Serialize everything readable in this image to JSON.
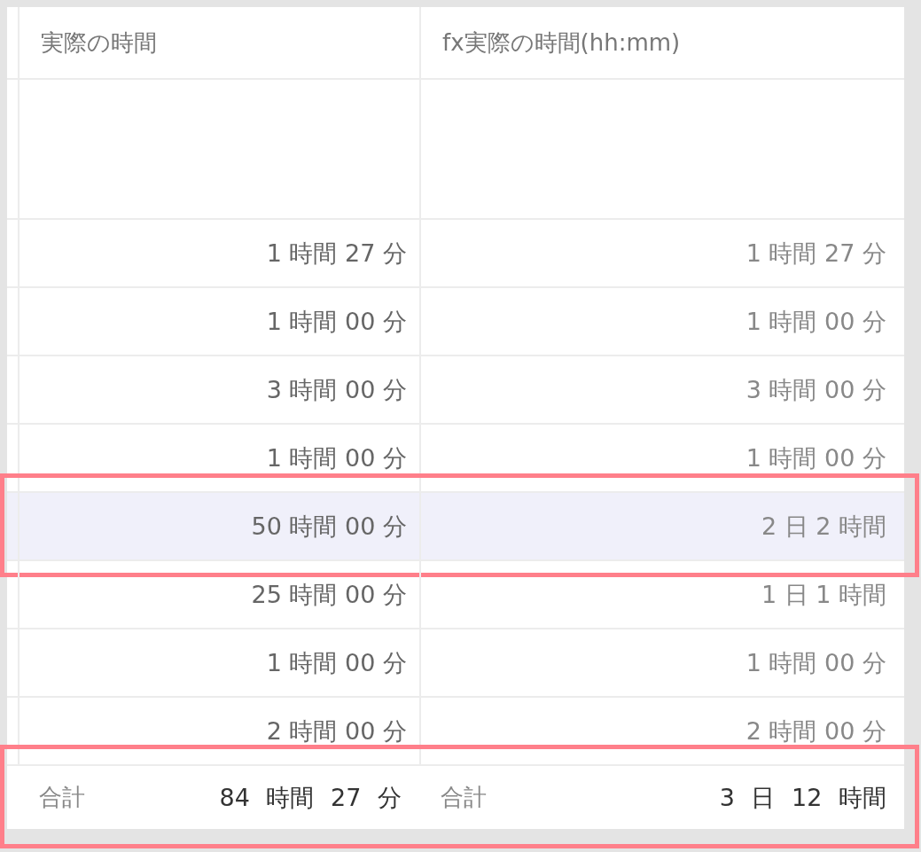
{
  "table": {
    "columns": [
      {
        "label": "実際の時間"
      },
      {
        "label": "fx実際の時間(hh:mm)"
      }
    ],
    "rows": [
      {
        "kind": "blank"
      },
      {
        "kind": "data",
        "cells": [
          "1 時間 27 分",
          "1 時間 27 分"
        ],
        "selected": false,
        "annotated": false
      },
      {
        "kind": "data",
        "cells": [
          "1 時間 00 分",
          "1 時間 00 分"
        ],
        "selected": false,
        "annotated": false
      },
      {
        "kind": "data",
        "cells": [
          "3 時間 00 分",
          "3 時間 00 分"
        ],
        "selected": false,
        "annotated": false
      },
      {
        "kind": "data",
        "cells": [
          "1 時間 00 分",
          "1 時間 00 分"
        ],
        "selected": false,
        "annotated": false
      },
      {
        "kind": "data",
        "cells": [
          "50 時間 00 分",
          "2 日 2 時間"
        ],
        "selected": true,
        "annotated": true
      },
      {
        "kind": "data",
        "cells": [
          "25 時間 00 分",
          "1 日 1 時間"
        ],
        "selected": false,
        "annotated": false
      },
      {
        "kind": "data",
        "cells": [
          "1 時間 00 分",
          "1 時間 00 分"
        ],
        "selected": false,
        "annotated": false
      },
      {
        "kind": "data",
        "cells": [
          "2 時間 00 分",
          "2 時間 00 分"
        ],
        "selected": false,
        "annotated": false
      }
    ],
    "footer": {
      "annotated": true,
      "totals": [
        {
          "label": "合計",
          "value": "84 時間 27 分"
        },
        {
          "label": "合計",
          "value": "3 日 12 時間"
        }
      ]
    }
  }
}
